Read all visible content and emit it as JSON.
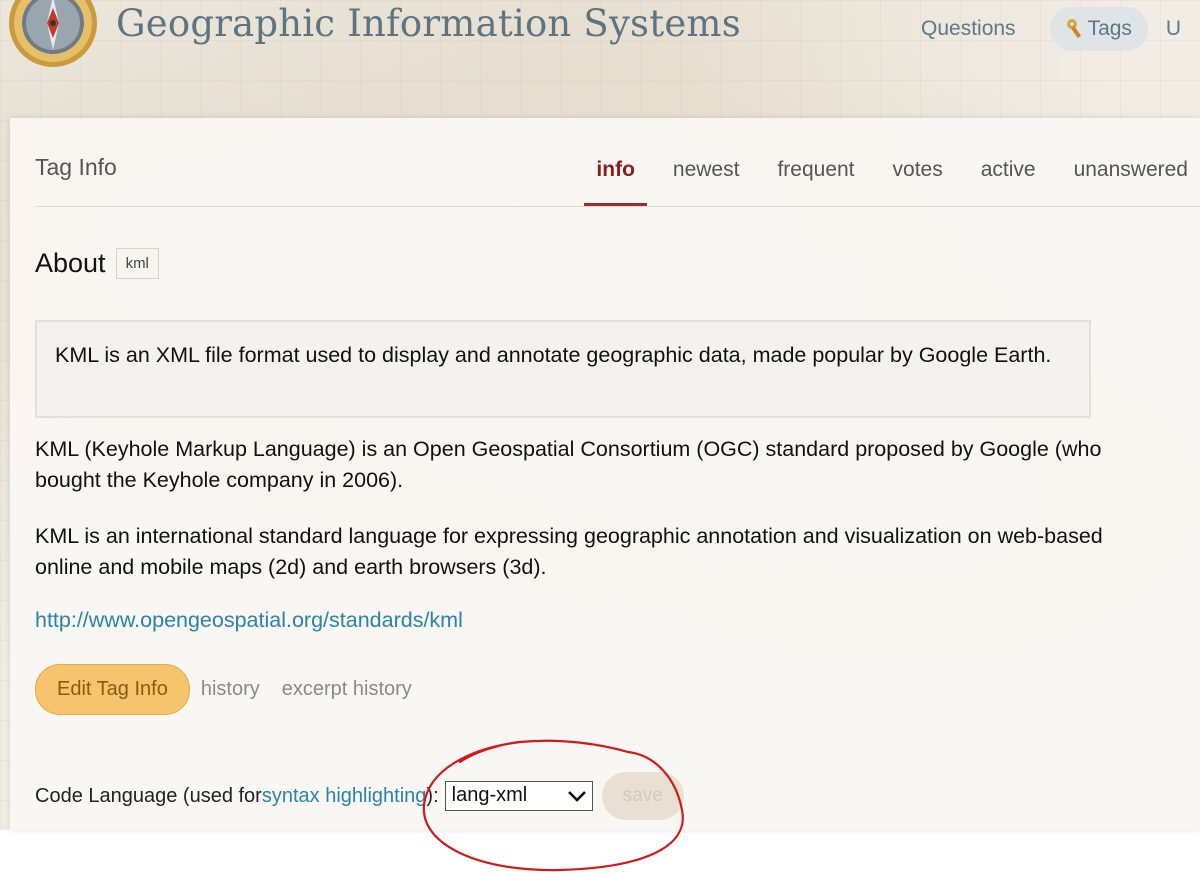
{
  "site": {
    "title": "Geographic Information Systems"
  },
  "top_nav": {
    "items": [
      {
        "label": "Questions"
      },
      {
        "label": "Tags"
      }
    ],
    "cut_off_label": "U"
  },
  "panel": {
    "title": "Tag Info",
    "tabs": [
      {
        "label": "info",
        "active": true
      },
      {
        "label": "newest"
      },
      {
        "label": "frequent"
      },
      {
        "label": "votes"
      },
      {
        "label": "active"
      },
      {
        "label": "unanswered"
      }
    ]
  },
  "about": {
    "label": "About",
    "tag": "kml"
  },
  "excerpt": "KML is an XML file format used to display and annotate geographic data, made popular by Google Earth.",
  "body": {
    "paragraphs": [
      "KML (Keyhole Markup Language) is an Open Geospatial Consortium (OGC) standard proposed by Google (who bought the Keyhole company in 2006).",
      "KML is an international standard language for expressing geographic annotation and visualization on web-based online and mobile maps (2d) and earth browsers (3d)."
    ],
    "link": "http://www.opengeospatial.org/standards/kml"
  },
  "actions": {
    "edit_label": "Edit Tag Info",
    "history_label": "history",
    "excerpt_history_label": "excerpt history"
  },
  "code_language": {
    "prefix": "Code Language (used for ",
    "link_text": "syntax highlighting",
    "suffix": "):",
    "selected": "lang-xml",
    "save_label": "save"
  },
  "colors": {
    "accent_active_tab": "#8c1d1d",
    "link": "#2a83a8",
    "edit_button": "#f5c46c",
    "annotation": "#d11a1a"
  },
  "icons": [
    "compass-logo-icon",
    "tag-icon",
    "chevron-down-icon"
  ]
}
